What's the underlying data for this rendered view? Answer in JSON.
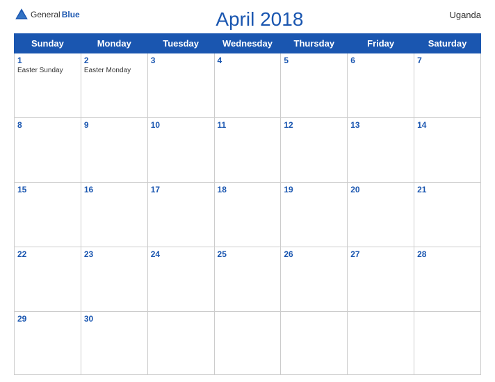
{
  "header": {
    "logo_general": "General",
    "logo_blue": "Blue",
    "title": "April 2018",
    "country": "Uganda"
  },
  "weekdays": [
    "Sunday",
    "Monday",
    "Tuesday",
    "Wednesday",
    "Thursday",
    "Friday",
    "Saturday"
  ],
  "weeks": [
    [
      {
        "day": "1",
        "holiday": "Easter Sunday"
      },
      {
        "day": "2",
        "holiday": "Easter Monday"
      },
      {
        "day": "3",
        "holiday": ""
      },
      {
        "day": "4",
        "holiday": ""
      },
      {
        "day": "5",
        "holiday": ""
      },
      {
        "day": "6",
        "holiday": ""
      },
      {
        "day": "7",
        "holiday": ""
      }
    ],
    [
      {
        "day": "8",
        "holiday": ""
      },
      {
        "day": "9",
        "holiday": ""
      },
      {
        "day": "10",
        "holiday": ""
      },
      {
        "day": "11",
        "holiday": ""
      },
      {
        "day": "12",
        "holiday": ""
      },
      {
        "day": "13",
        "holiday": ""
      },
      {
        "day": "14",
        "holiday": ""
      }
    ],
    [
      {
        "day": "15",
        "holiday": ""
      },
      {
        "day": "16",
        "holiday": ""
      },
      {
        "day": "17",
        "holiday": ""
      },
      {
        "day": "18",
        "holiday": ""
      },
      {
        "day": "19",
        "holiday": ""
      },
      {
        "day": "20",
        "holiday": ""
      },
      {
        "day": "21",
        "holiday": ""
      }
    ],
    [
      {
        "day": "22",
        "holiday": ""
      },
      {
        "day": "23",
        "holiday": ""
      },
      {
        "day": "24",
        "holiday": ""
      },
      {
        "day": "25",
        "holiday": ""
      },
      {
        "day": "26",
        "holiday": ""
      },
      {
        "day": "27",
        "holiday": ""
      },
      {
        "day": "28",
        "holiday": ""
      }
    ],
    [
      {
        "day": "29",
        "holiday": ""
      },
      {
        "day": "30",
        "holiday": ""
      },
      {
        "day": "",
        "holiday": ""
      },
      {
        "day": "",
        "holiday": ""
      },
      {
        "day": "",
        "holiday": ""
      },
      {
        "day": "",
        "holiday": ""
      },
      {
        "day": "",
        "holiday": ""
      }
    ]
  ]
}
